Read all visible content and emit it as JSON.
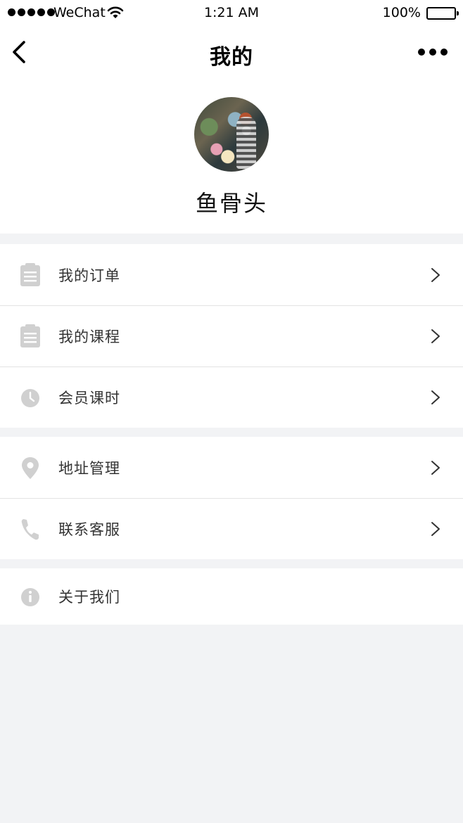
{
  "status_bar": {
    "carrier": "WeChat",
    "time": "1:21 AM",
    "battery": "100%",
    "battery_level": 1.0,
    "signal_bars": 5
  },
  "nav": {
    "title": "我的",
    "back_icon": "chevron-left-icon",
    "more_icon": "more-dots-icon"
  },
  "profile": {
    "username": "鱼骨头"
  },
  "menu": {
    "group1": [
      {
        "label": "我的订单",
        "icon": "clipboard-icon"
      },
      {
        "label": "我的课程",
        "icon": "clipboard-icon"
      },
      {
        "label": "会员课时",
        "icon": "clock-icon"
      }
    ],
    "group2": [
      {
        "label": "地址管理",
        "icon": "location-pin-icon"
      },
      {
        "label": "联系客服",
        "icon": "phone-icon"
      }
    ],
    "group3": [
      {
        "label": "关于我们",
        "icon": "info-icon"
      }
    ]
  },
  "colors": {
    "background": "#f2f3f5",
    "icon_gray": "#cfcfcf",
    "text": "#333333"
  }
}
